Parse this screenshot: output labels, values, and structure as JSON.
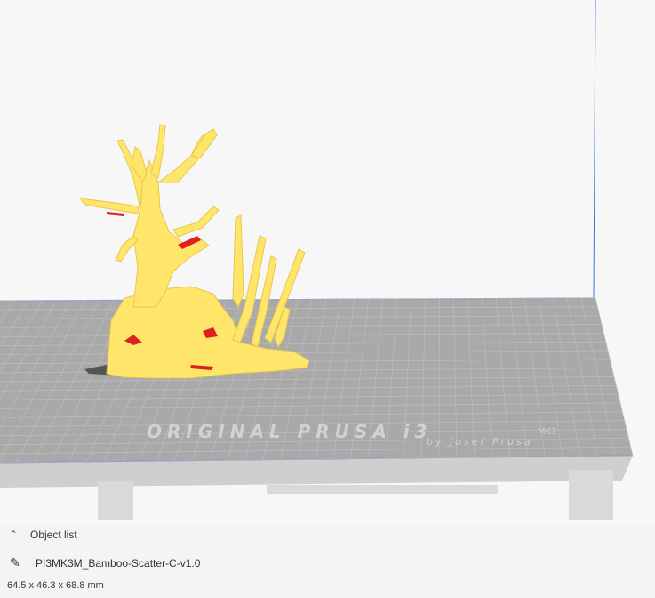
{
  "viewport": {
    "bed_brand_text": "ORIGINAL PRUSA i3",
    "bed_model_text": "MK3",
    "bed_author_text": "by Josef Prusa",
    "colors": {
      "background": "#f7f7f7",
      "bed": "#a9a9a9",
      "grid": "#bdbdbd",
      "volume_edge": "#3a7bd5",
      "model": "#ffe66b",
      "model_highlight": "#e02020"
    }
  },
  "object_list": {
    "toggle_icon": "chevron-up-icon",
    "title": "Object list",
    "edit_icon": "pencil-icon",
    "object_name": "PI3MK3M_Bamboo-Scatter-C-v1.0",
    "dimensions": "64.5 x 46.3 x 68.8 mm"
  }
}
